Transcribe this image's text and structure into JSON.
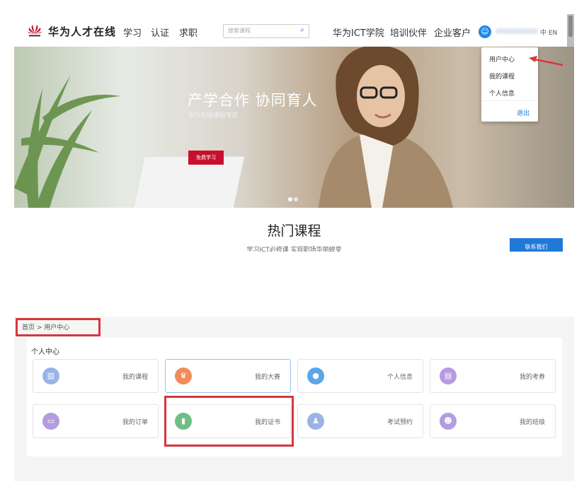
{
  "top": {
    "brand": "华为人才在线",
    "nav": [
      "学习",
      "认证",
      "求职"
    ],
    "search_placeholder": "搜索课程",
    "nav_right": [
      "华为ICT学院",
      "培训伙伴",
      "企业客户"
    ],
    "lang": "中 EN",
    "dropdown": {
      "items": [
        "用户中心",
        "我的课程",
        "个人信息"
      ],
      "logout": "退出"
    },
    "hero": {
      "title": "产学合作 协同育人",
      "subtitle": "华为在线课程专区",
      "button": "免费学习"
    },
    "hot": {
      "title": "热门课程",
      "subtitle": "学习ICT必修课  实现职场华丽蜕变",
      "contact": "联系我们"
    }
  },
  "bottom": {
    "breadcrumb": "首页 > 用户中心",
    "panel_title": "个人中心",
    "cards": [
      {
        "label": "我的课程",
        "icon": "book-icon",
        "color": "#9bb4e6",
        "glyph": "▥"
      },
      {
        "label": "我的大赛",
        "icon": "trophy-icon",
        "color": "#ef8c5a",
        "glyph": "♛"
      },
      {
        "label": "个人信息",
        "icon": "user-icon",
        "color": "#5ba6e6",
        "glyph": "●"
      },
      {
        "label": "我的考券",
        "icon": "ticket-icon",
        "color": "#b59be0",
        "glyph": "▤"
      },
      {
        "label": "我的订单",
        "icon": "order-icon",
        "color": "#b59be0",
        "glyph": "▭"
      },
      {
        "label": "我的证书",
        "icon": "certificate-icon",
        "color": "#6fbf84",
        "glyph": "▮"
      },
      {
        "label": "考试预约",
        "icon": "exam-booking-icon",
        "color": "#9bb4e6",
        "glyph": "♟"
      },
      {
        "label": "我的班级",
        "icon": "class-icon",
        "color": "#b59be0",
        "glyph": "☻"
      }
    ]
  },
  "colors": {
    "huawei_red": "#c8102e",
    "accent_blue": "#1f79d6",
    "highlight_red": "#d9363e"
  }
}
